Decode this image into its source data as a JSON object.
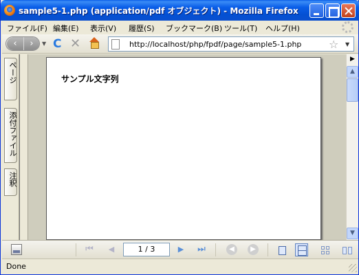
{
  "window": {
    "title": "sample5-1.php (application/pdf オブジェクト) - Mozilla Firefox"
  },
  "menu": {
    "items": [
      {
        "label": "ファイル(F)"
      },
      {
        "label": "編集(E)"
      },
      {
        "label": "表示(V)"
      },
      {
        "label": "履歴(S)"
      },
      {
        "label": "ブックマーク(B)"
      },
      {
        "label": "ツール(T)"
      },
      {
        "label": "ヘルプ(H)"
      }
    ]
  },
  "nav": {
    "back_glyph": "‹",
    "forward_glyph": "›",
    "reload_glyph": "C",
    "stop_glyph": "✕",
    "url": "http://localhost/php/fpdf/page/sample5-1.php",
    "star_glyph": "☆",
    "icons": [
      "back-icon",
      "forward-icon",
      "reload-icon",
      "stop-icon",
      "home-icon",
      "page-favicon-icon",
      "bookmark-star-icon"
    ]
  },
  "sidebar": {
    "tabs": [
      {
        "label": "ページ"
      },
      {
        "label": "添付ファイル"
      },
      {
        "label": "注釈"
      }
    ]
  },
  "document": {
    "text": "サンプル文字列"
  },
  "pdf_toolbar": {
    "page_indicator": "1 / 3",
    "first_glyph": "⏮",
    "prev_glyph": "◀",
    "next_glyph": "▶",
    "last_glyph": "⏭",
    "back_view_glyph": "◀",
    "forward_view_glyph": "▶"
  },
  "status": {
    "text": "Done"
  },
  "colors": {
    "titlebar": "#0a5ee8",
    "chrome": "#ece9d8",
    "scroll_accent": "#c2d6fb"
  }
}
